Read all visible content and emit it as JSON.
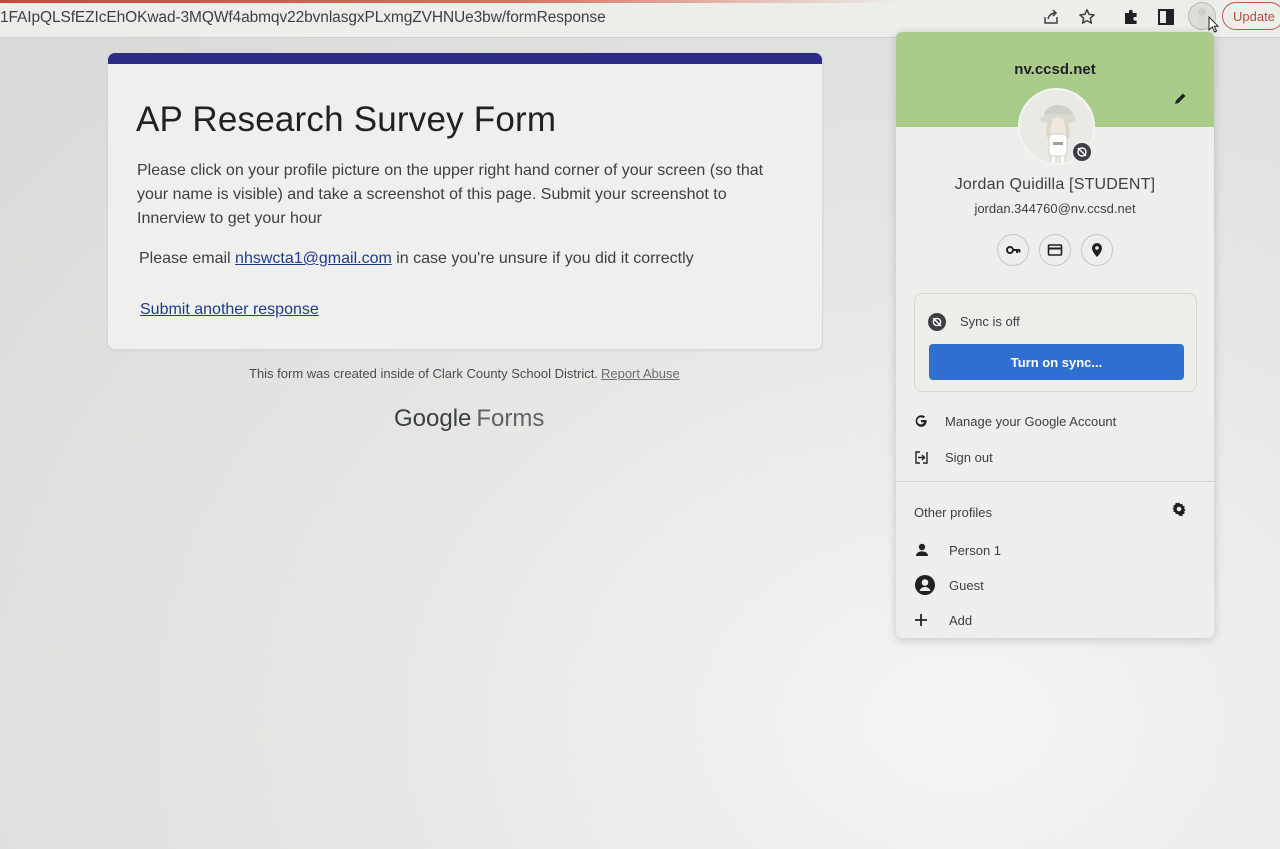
{
  "browser": {
    "url": "1FAIpQLSfEZIcEhOKwad-3MQWf4abmqv22bvnlasgxPLxmgZVHNUe3bw/formResponse",
    "update_label": "Update",
    "icons": [
      "share-icon",
      "bookmark-star-icon",
      "extensions-icon",
      "side-panel-icon",
      "profile-avatar-icon"
    ]
  },
  "form": {
    "title": "AP Research Survey Form",
    "description": "Please click on your profile picture on the upper right hand corner of your screen (so that your name is visible) and take a screenshot of this page. Submit your screenshot to Innerview to get your hour",
    "email_prefix": "Please email ",
    "email_link": "nhswcta1@gmail.com",
    "email_suffix": " in case you're unsure if you did it correctly",
    "submit_another": "Submit another response",
    "accent_color": "#2b2d86"
  },
  "footer": {
    "note": "This form was created inside of Clark County School District.",
    "report_abuse": "Report Abuse",
    "brand_google": "Google",
    "brand_forms": "Forms"
  },
  "profile": {
    "domain": "nv.ccsd.net",
    "name": "Jordan Quidilla [STUDENT]",
    "email": "jordan.344760@nv.ccsd.net",
    "header_color": "#a9cc8a",
    "quick_icons": [
      "password-key-icon",
      "payment-card-icon",
      "address-pin-icon"
    ],
    "sync_status": "Sync is off",
    "sync_button": "Turn on sync...",
    "manage_account": "Manage your Google Account",
    "sign_out": "Sign out",
    "other_profiles_label": "Other profiles",
    "other_profiles": [
      {
        "label": "Person 1",
        "icon": "person-icon"
      },
      {
        "label": "Guest",
        "icon": "guest-icon"
      },
      {
        "label": "Add",
        "icon": "add-icon"
      }
    ]
  }
}
